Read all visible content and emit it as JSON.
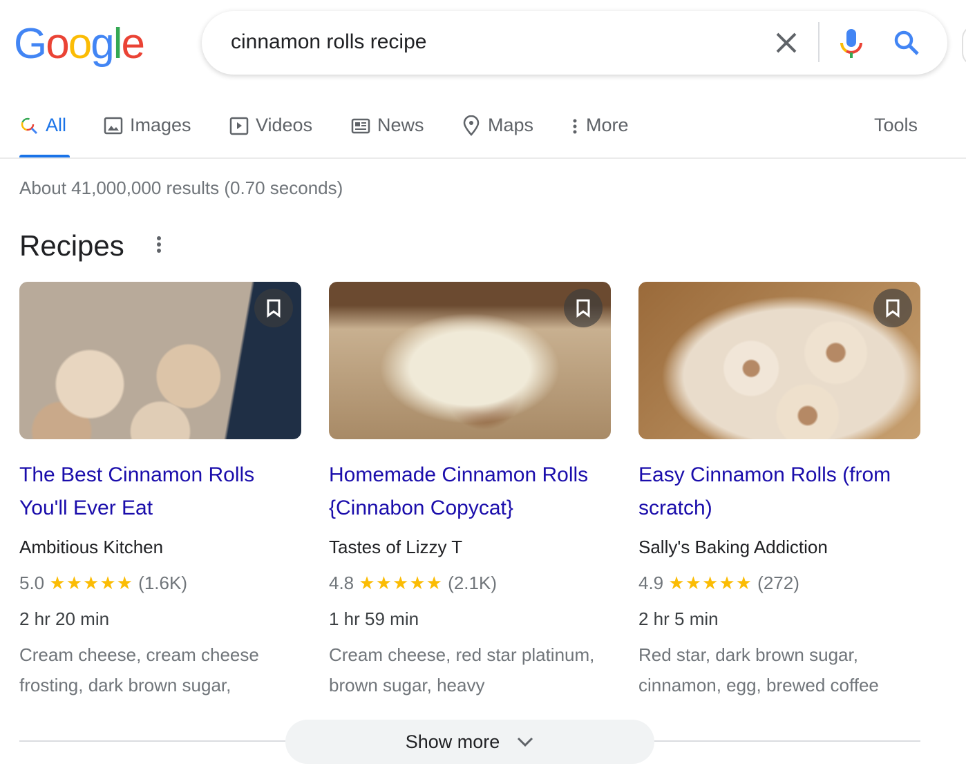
{
  "logo": {
    "letters": [
      "G",
      "o",
      "o",
      "g",
      "l",
      "e"
    ],
    "colors": [
      "#4285f4",
      "#ea4335",
      "#fbbc05",
      "#4285f4",
      "#34a853",
      "#ea4335"
    ]
  },
  "search": {
    "query": "cinnamon rolls recipe"
  },
  "tabs": [
    {
      "label": "All",
      "icon": "search-icon"
    },
    {
      "label": "Images",
      "icon": "image-icon"
    },
    {
      "label": "Videos",
      "icon": "play-icon"
    },
    {
      "label": "News",
      "icon": "news-icon"
    },
    {
      "label": "Maps",
      "icon": "map-pin-icon"
    },
    {
      "label": "More",
      "icon": "more-vert-icon"
    }
  ],
  "tools_label": "Tools",
  "stats": "About 41,000,000 results (0.70 seconds)",
  "recipes": {
    "heading": "Recipes",
    "cards": [
      {
        "title": "The Best Cinnamon Rolls You'll Ever Eat",
        "source": "Ambitious Kitchen",
        "rating": "5.0",
        "stars": "★★★★★",
        "count": "(1.6K)",
        "time": "2 hr 20 min",
        "ingredients": "Cream cheese, cream cheese frosting, dark brown sugar,"
      },
      {
        "title": "Homemade Cinnamon Rolls {Cinnabon Copycat}",
        "source": "Tastes of Lizzy T",
        "rating": "4.8",
        "stars": "★★★★★",
        "count": "(2.1K)",
        "time": "1 hr 59 min",
        "ingredients": "Cream cheese, red star platinum, brown sugar, heavy"
      },
      {
        "title": "Easy Cinnamon Rolls (from scratch)",
        "source": "Sally's Baking Addiction",
        "rating": "4.9",
        "stars": "★★★★★",
        "count": "(272)",
        "time": "2 hr 5 min",
        "ingredients": "Red star, dark brown sugar, cinnamon, egg, brewed coffee"
      }
    ],
    "show_more": "Show more"
  },
  "colors": {
    "accent": "#1a73e8",
    "link": "#1a0dab",
    "star": "#fbbc04"
  }
}
